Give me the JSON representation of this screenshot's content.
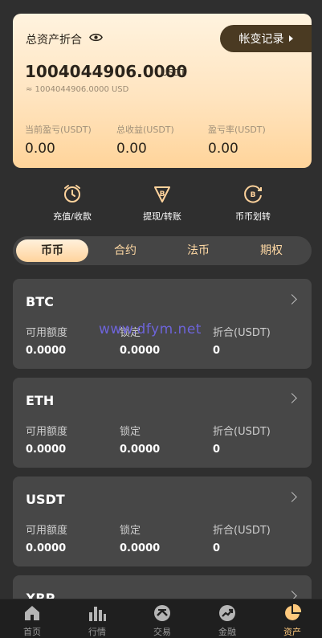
{
  "asset_card": {
    "title": "总资产折合",
    "record_button": "帐变记录",
    "total_value": "1004044906.0000",
    "total_unit": "USDT",
    "usd_value": "≈ 1004044906.0000 USD",
    "stats": [
      {
        "label": "当前盈亏(USDT)",
        "value": "0.00"
      },
      {
        "label": "总收益(USDT)",
        "value": "0.00"
      },
      {
        "label": "盈亏率(USDT)",
        "value": "0.00"
      }
    ]
  },
  "actions": [
    {
      "label": "充值/收款",
      "icon": "deposit-clock-icon"
    },
    {
      "label": "提现/转账",
      "icon": "withdraw-bitcoin-icon"
    },
    {
      "label": "币币划转",
      "icon": "transfer-bitcoin-icon"
    }
  ],
  "tabs": [
    "币币",
    "合约",
    "法币",
    "期权"
  ],
  "active_tab": "币币",
  "column_labels": {
    "available": "可用额度",
    "locked": "锁定",
    "converted": "折合(USDT)"
  },
  "coins": [
    {
      "name": "BTC",
      "available": "0.0000",
      "locked": "0.0000",
      "converted": "0"
    },
    {
      "name": "ETH",
      "available": "0.0000",
      "locked": "0.0000",
      "converted": "0"
    },
    {
      "name": "USDT",
      "available": "0.0000",
      "locked": "0.0000",
      "converted": "0"
    },
    {
      "name": "XRP"
    }
  ],
  "watermark": "www.dfym.net",
  "bottom_nav": [
    {
      "label": "首页",
      "icon": "home-icon"
    },
    {
      "label": "行情",
      "icon": "market-bars-icon"
    },
    {
      "label": "交易",
      "icon": "trade-icon"
    },
    {
      "label": "金融",
      "icon": "finance-trend-icon"
    },
    {
      "label": "资产",
      "icon": "assets-pie-icon"
    }
  ],
  "colors": {
    "background": "#2f2f2f",
    "card": "#474747",
    "accent": "#ffd39c",
    "record_button": "#4a3a22"
  }
}
